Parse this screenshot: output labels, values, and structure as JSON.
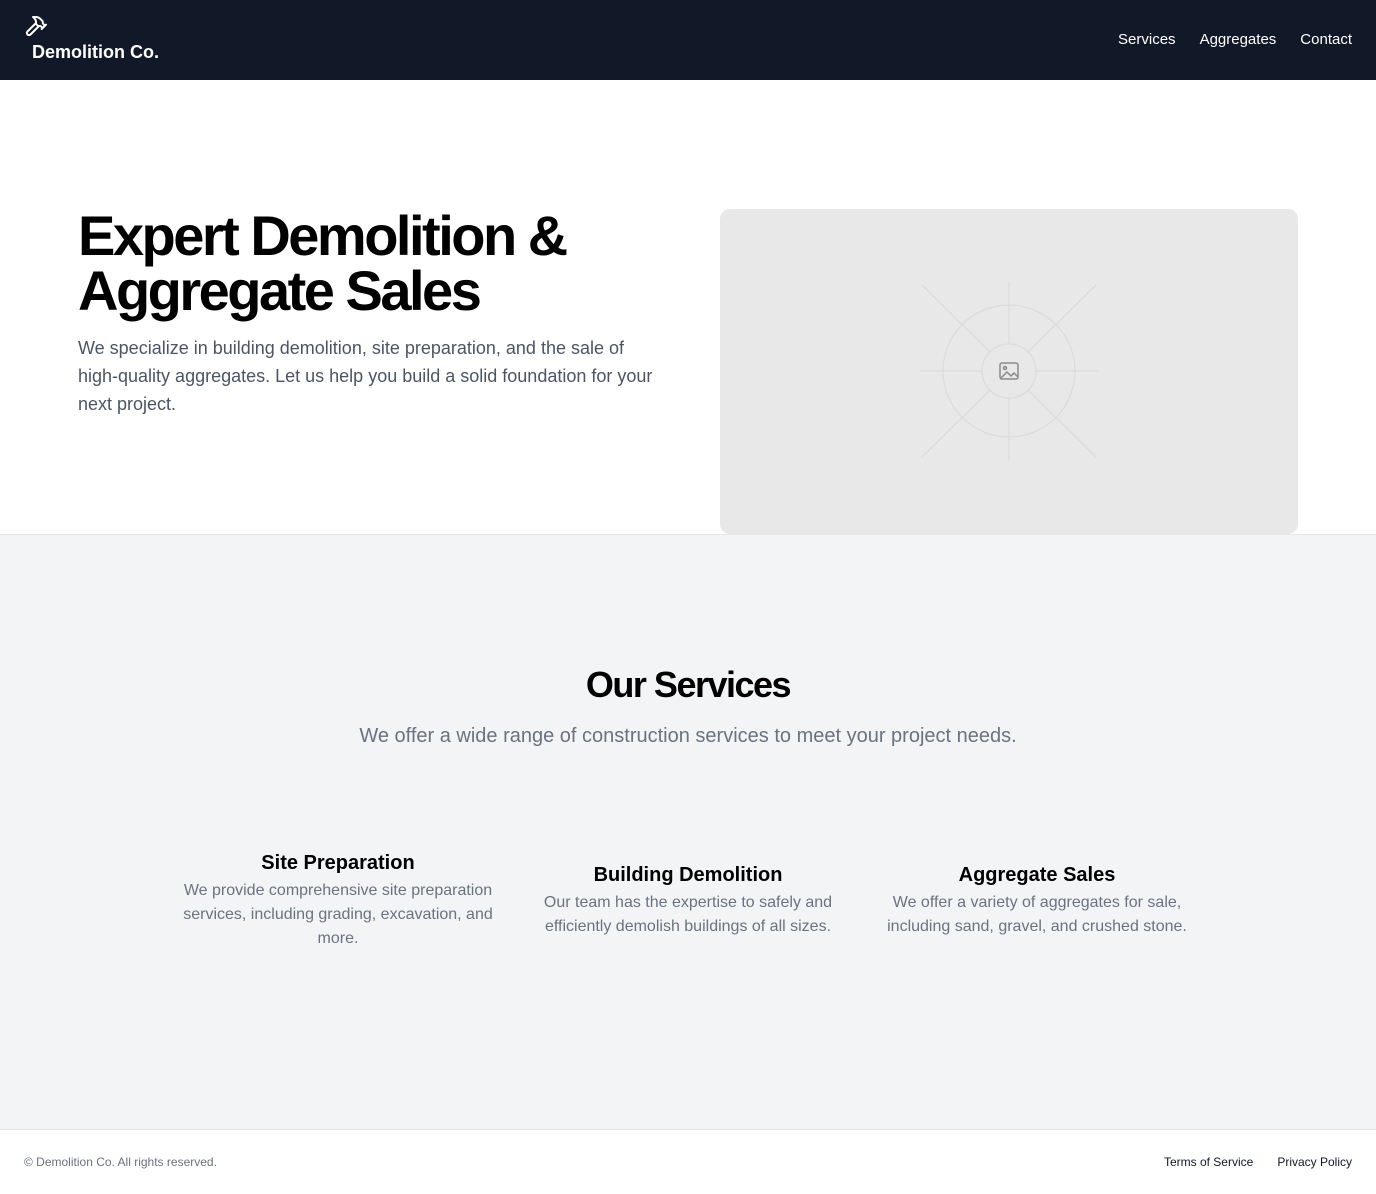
{
  "header": {
    "brand": "Demolition Co.",
    "brand_icon": "hammer-icon",
    "nav": [
      "Services",
      "Aggregates",
      "Contact"
    ]
  },
  "hero": {
    "title": "Expert Demolition & Aggregate Sales",
    "text": "We specialize in building demolition, site preparation, and the sale of high-quality aggregates. Let us help you build a solid foundation for your next project.",
    "image_icon": "image-placeholder-icon"
  },
  "services": {
    "title": "Our Services",
    "subtitle": "We offer a wide range of construction services to meet your project needs.",
    "cards": [
      {
        "title": "Site Preparation",
        "text": "We provide comprehensive site preparation services, including grading, excavation, and more."
      },
      {
        "title": "Building Demolition",
        "text": "Our team has the expertise to safely and efficiently demolish buildings of all sizes."
      },
      {
        "title": "Aggregate Sales",
        "text": "We offer a variety of aggregates for sale, including sand, gravel, and crushed stone."
      }
    ]
  },
  "footer": {
    "copyright": "© Demolition Co. All rights reserved.",
    "links": [
      "Terms of Service",
      "Privacy Policy"
    ]
  },
  "colors": {
    "header_bg": "#111827",
    "services_bg": "#f3f4f6",
    "muted_text": "#6b7280",
    "placeholder_bg": "#e8e8e8"
  }
}
